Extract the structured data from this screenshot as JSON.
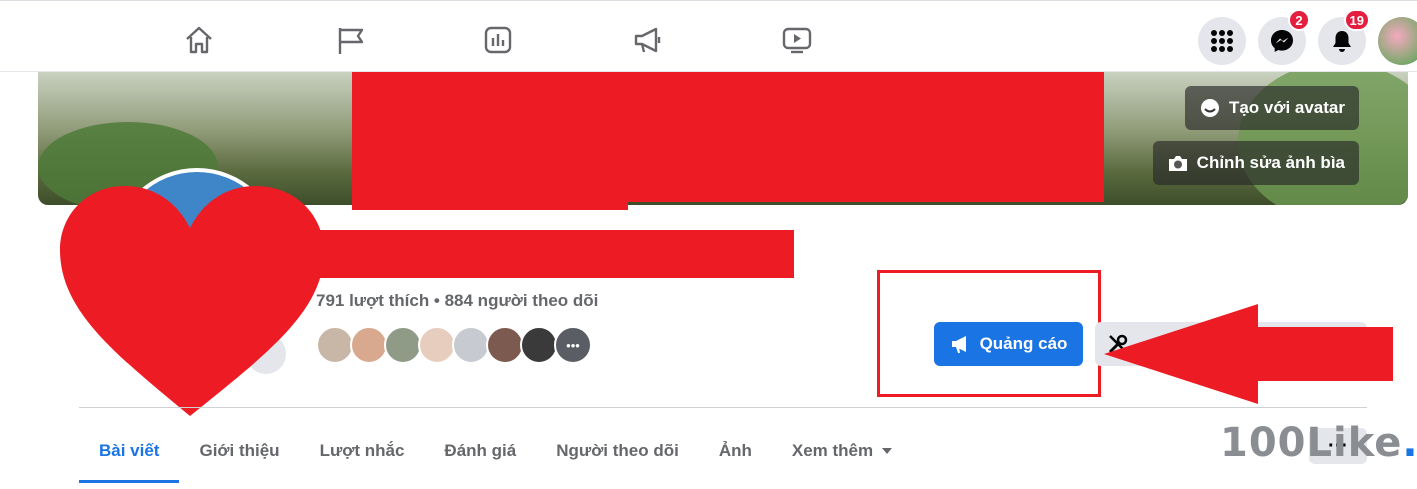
{
  "topbar": {
    "nav_icons": [
      "home-icon",
      "flag-icon",
      "chart-icon",
      "megaphone-icon",
      "video-icon"
    ],
    "menu_icon": "grid-menu-icon",
    "messenger": {
      "icon": "messenger-icon",
      "badge": "2"
    },
    "notifications": {
      "icon": "bell-icon",
      "badge": "19"
    }
  },
  "cover": {
    "create_avatar_label": "Tạo với avatar",
    "edit_cover_label": "Chỉnh sửa ảnh bìa"
  },
  "profile": {
    "stats": "791 lượt thích • 884 người theo dõi"
  },
  "actions": {
    "ad_label": "Quảng cáo"
  },
  "tabs": [
    {
      "label": "Bài viết",
      "active": true
    },
    {
      "label": "Giới thiệu"
    },
    {
      "label": "Lượt nhắc"
    },
    {
      "label": "Đánh giá"
    },
    {
      "label": "Người theo dõi"
    },
    {
      "label": "Ảnh"
    },
    {
      "label": "Xem thêm"
    }
  ],
  "more_label": "···",
  "watermark": {
    "text": "100Like",
    "dot": "."
  },
  "colors": {
    "accent": "#1b74e4",
    "badge": "#e41e3f",
    "annotation_red": "#ed1c24"
  }
}
